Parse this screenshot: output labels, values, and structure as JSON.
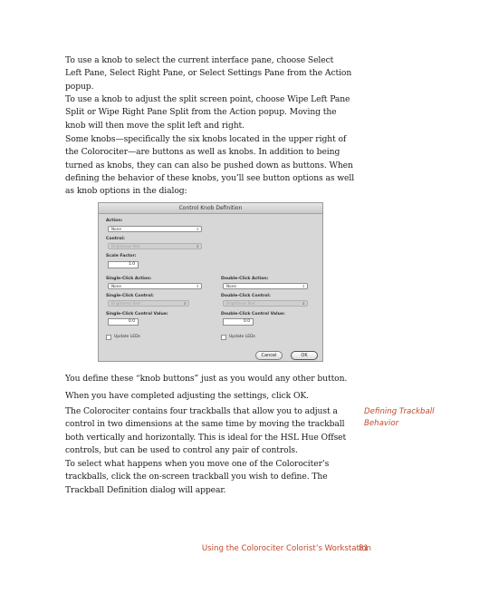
{
  "para1": [
    "To use a knob to select the current interface pane, choose Select",
    "Left Pane, Select Right Pane, or Select Settings Pane from the Action",
    "popup."
  ],
  "para2": [
    "To use a knob to adjust the split screen point, choose Wipe Left Pane",
    "Split or Wipe Right Pane Split from the Action popup. Moving the",
    "knob will then move the split left and right."
  ],
  "para3": [
    "Some knobs—specifically the six knobs located in the upper right of",
    "the Colorociter—are buttons as well as knobs. In addition to being",
    "turned as knobs, they can can also be pushed down as buttons. When",
    "defining the behavior of these knobs, you’ll see button options as well",
    "as knob options in the dialog:"
  ],
  "dialog": {
    "title": "Control Knob Definition",
    "action_label": "Action:",
    "action_value": "None",
    "control_label": "Control:",
    "control_value": "Brightness Red",
    "scale_label": "Scale Factor:",
    "scale_value": "1.0",
    "single_action_label": "Single-Click Action:",
    "single_action_value": "None",
    "double_action_label": "Double-Click Action:",
    "double_action_value": "None",
    "single_control_label": "Single-Click Control:",
    "single_control_value": "Brightness Red",
    "double_control_label": "Double-Click Control:",
    "double_control_value": "Brightness Red",
    "single_value_label": "Single-Click Control Value:",
    "single_value": "0.0",
    "double_value_label": "Double-Click Control Value:",
    "double_value": "0.0",
    "update_leds_1": "Update LEDs",
    "update_leds_2": "Update LEDs",
    "cancel": "Cancel",
    "ok": "OK"
  },
  "para4": [
    "You define these “knob buttons” just as you would any other button."
  ],
  "para5": [
    "When you have completed adjusting the settings, click OK."
  ],
  "para6": [
    "The Colorociter contains four trackballs that allow you to adjust a",
    "control in two dimensions at the same time by moving the trackball",
    "both vertically and horizontally. This is ideal for the HSL Hue Offset",
    "controls, but can be used to control any pair of controls."
  ],
  "para7": [
    "To select what happens when you move one of the Colorociter’s",
    "trackballs, click the on-screen trackball you wish to define. The",
    "Trackball Definition dialog will appear."
  ],
  "sidehead": [
    "Defining Trackball",
    "Behavior"
  ],
  "footer": {
    "text": "Using the Colorociter Colorist’s Workstation",
    "page": "81"
  }
}
